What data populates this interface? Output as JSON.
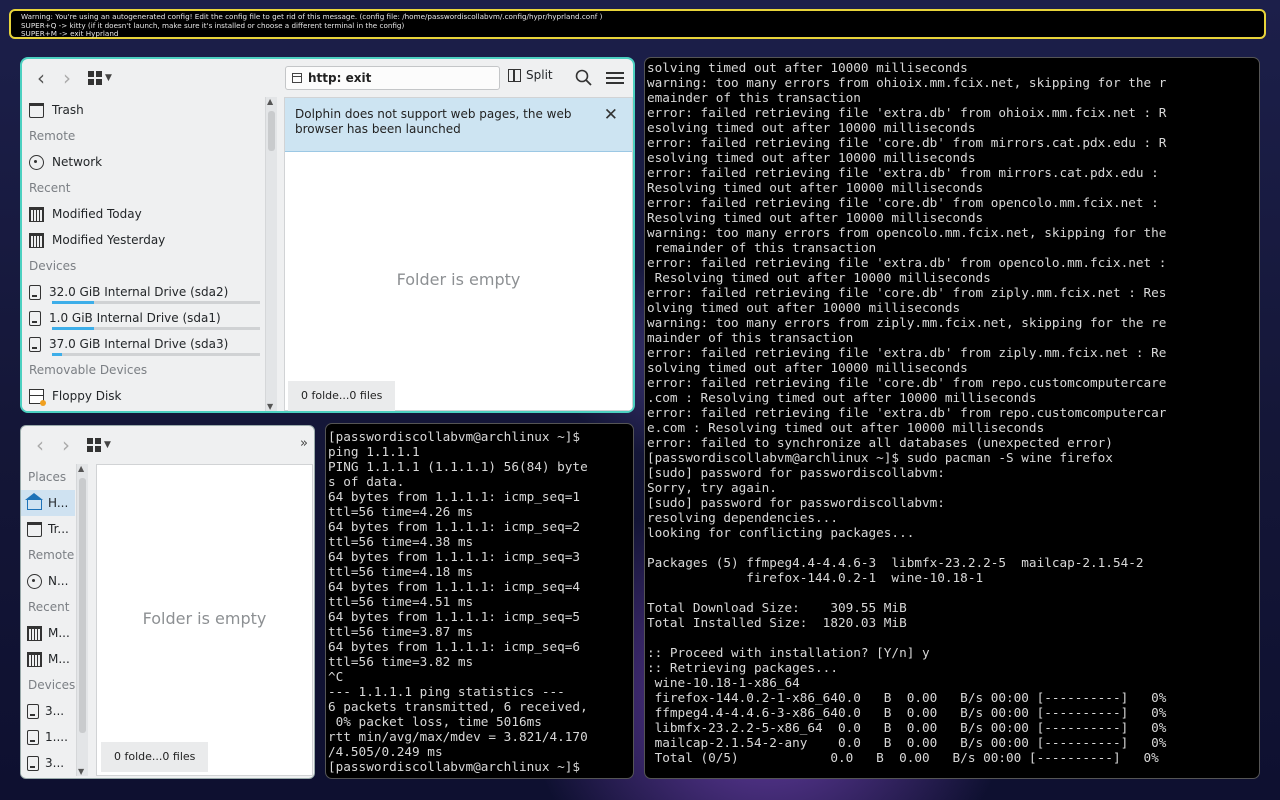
{
  "warning_bar": {
    "lines": [
      "Warning: You're using an autogenerated config! Edit the config file to get rid of this message. (config file: /home/passwordiscollabvm/.config/hypr/hyprland.conf )",
      "SUPER+Q -> kitty (if it doesn't launch, make sure it's installed or choose a different terminal in the config)",
      "SUPER+M -> exit Hyprland"
    ]
  },
  "dolphin_top": {
    "address": "http: exit",
    "split_label": "Split",
    "sidebar": {
      "trash": "Trash",
      "remote_header": "Remote",
      "network": "Network",
      "recent_header": "Recent",
      "modified_today": "Modified Today",
      "modified_yesterday": "Modified Yesterday",
      "devices_header": "Devices",
      "drives": [
        {
          "label": "32.0 GiB Internal Drive (sda2)",
          "used_fraction": 0.2
        },
        {
          "label": "1.0 GiB Internal Drive (sda1)",
          "used_fraction": 0.2
        },
        {
          "label": "37.0 GiB Internal Drive (sda3)",
          "used_fraction": 0.05
        }
      ],
      "removable_header": "Removable Devices",
      "floppy": "Floppy Disk"
    },
    "banner": "Dolphin does not support web pages, the web browser has been launched",
    "empty_text": "Folder is empty",
    "status": "0 folde...0 files"
  },
  "dolphin_bottom": {
    "sidebar": {
      "places_header": "Places",
      "home": "H...",
      "trash": "Tr...",
      "remote_header": "Remote",
      "network": "N...",
      "recent_header": "Recent",
      "modified_today": "M...",
      "modified_yesterday": "M...",
      "devices_header": "Devices",
      "drive1": "3...",
      "drive2": "1....",
      "drive3": "3..."
    },
    "empty_text": "Folder is empty",
    "status": "0 folde...0 files",
    "overflow_icon": "»"
  },
  "terminal_small": {
    "lines": [
      "[passwordiscollabvm@archlinux ~]$",
      "ping 1.1.1.1",
      "PING 1.1.1.1 (1.1.1.1) 56(84) byte",
      "s of data.",
      "64 bytes from 1.1.1.1: icmp_seq=1",
      "ttl=56 time=4.26 ms",
      "64 bytes from 1.1.1.1: icmp_seq=2",
      "ttl=56 time=4.38 ms",
      "64 bytes from 1.1.1.1: icmp_seq=3",
      "ttl=56 time=4.18 ms",
      "64 bytes from 1.1.1.1: icmp_seq=4",
      "ttl=56 time=4.51 ms",
      "64 bytes from 1.1.1.1: icmp_seq=5",
      "ttl=56 time=3.87 ms",
      "64 bytes from 1.1.1.1: icmp_seq=6",
      "ttl=56 time=3.82 ms",
      "^C",
      "--- 1.1.1.1 ping statistics ---",
      "6 packets transmitted, 6 received,",
      " 0% packet loss, time 5016ms",
      "rtt min/avg/max/mdev = 3.821/4.170",
      "/4.505/0.249 ms",
      "[passwordiscollabvm@archlinux ~]$ "
    ]
  },
  "terminal_main": {
    "lines": [
      "solving timed out after 10000 milliseconds",
      "warning: too many errors from ohioix.mm.fcix.net, skipping for the r",
      "emainder of this transaction",
      "error: failed retrieving file 'extra.db' from ohioix.mm.fcix.net : R",
      "esolving timed out after 10000 milliseconds",
      "error: failed retrieving file 'core.db' from mirrors.cat.pdx.edu : R",
      "esolving timed out after 10000 milliseconds",
      "error: failed retrieving file 'extra.db' from mirrors.cat.pdx.edu :",
      "Resolving timed out after 10000 milliseconds",
      "error: failed retrieving file 'core.db' from opencolo.mm.fcix.net :",
      "Resolving timed out after 10000 milliseconds",
      "warning: too many errors from opencolo.mm.fcix.net, skipping for the",
      " remainder of this transaction",
      "error: failed retrieving file 'extra.db' from opencolo.mm.fcix.net :",
      " Resolving timed out after 10000 milliseconds",
      "error: failed retrieving file 'core.db' from ziply.mm.fcix.net : Res",
      "olving timed out after 10000 milliseconds",
      "warning: too many errors from ziply.mm.fcix.net, skipping for the re",
      "mainder of this transaction",
      "error: failed retrieving file 'extra.db' from ziply.mm.fcix.net : Re",
      "solving timed out after 10000 milliseconds",
      "error: failed retrieving file 'core.db' from repo.customcomputercare",
      ".com : Resolving timed out after 10000 milliseconds",
      "error: failed retrieving file 'extra.db' from repo.customcomputercar",
      "e.com : Resolving timed out after 10000 milliseconds",
      "error: failed to synchronize all databases (unexpected error)",
      "[passwordiscollabvm@archlinux ~]$ sudo pacman -S wine firefox",
      "[sudo] password for passwordiscollabvm:",
      "Sorry, try again.",
      "[sudo] password for passwordiscollabvm:",
      "resolving dependencies...",
      "looking for conflicting packages...",
      "",
      "Packages (5) ffmpeg4.4-4.4.6-3  libmfx-23.2.2-5  mailcap-2.1.54-2",
      "             firefox-144.0.2-1  wine-10.18-1",
      "",
      "Total Download Size:    309.55 MiB",
      "Total Installed Size:  1820.03 MiB",
      "",
      ":: Proceed with installation? [Y/n] y",
      ":: Retrieving packages...",
      " wine-10.18-1-x86_64",
      " firefox-144.0.2-1-x86_640.0   B  0.00   B/s 00:00 [----------]   0%",
      " ffmpeg4.4-4.4.6-3-x86_640.0   B  0.00   B/s 00:00 [----------]   0%",
      " libmfx-23.2.2-5-x86_64  0.0   B  0.00   B/s 00:00 [----------]   0%",
      " mailcap-2.1.54-2-any    0.0   B  0.00   B/s 00:00 [----------]   0%",
      " Total (0/5)            0.0   B  0.00   B/s 00:00 [----------]   0%"
    ]
  }
}
